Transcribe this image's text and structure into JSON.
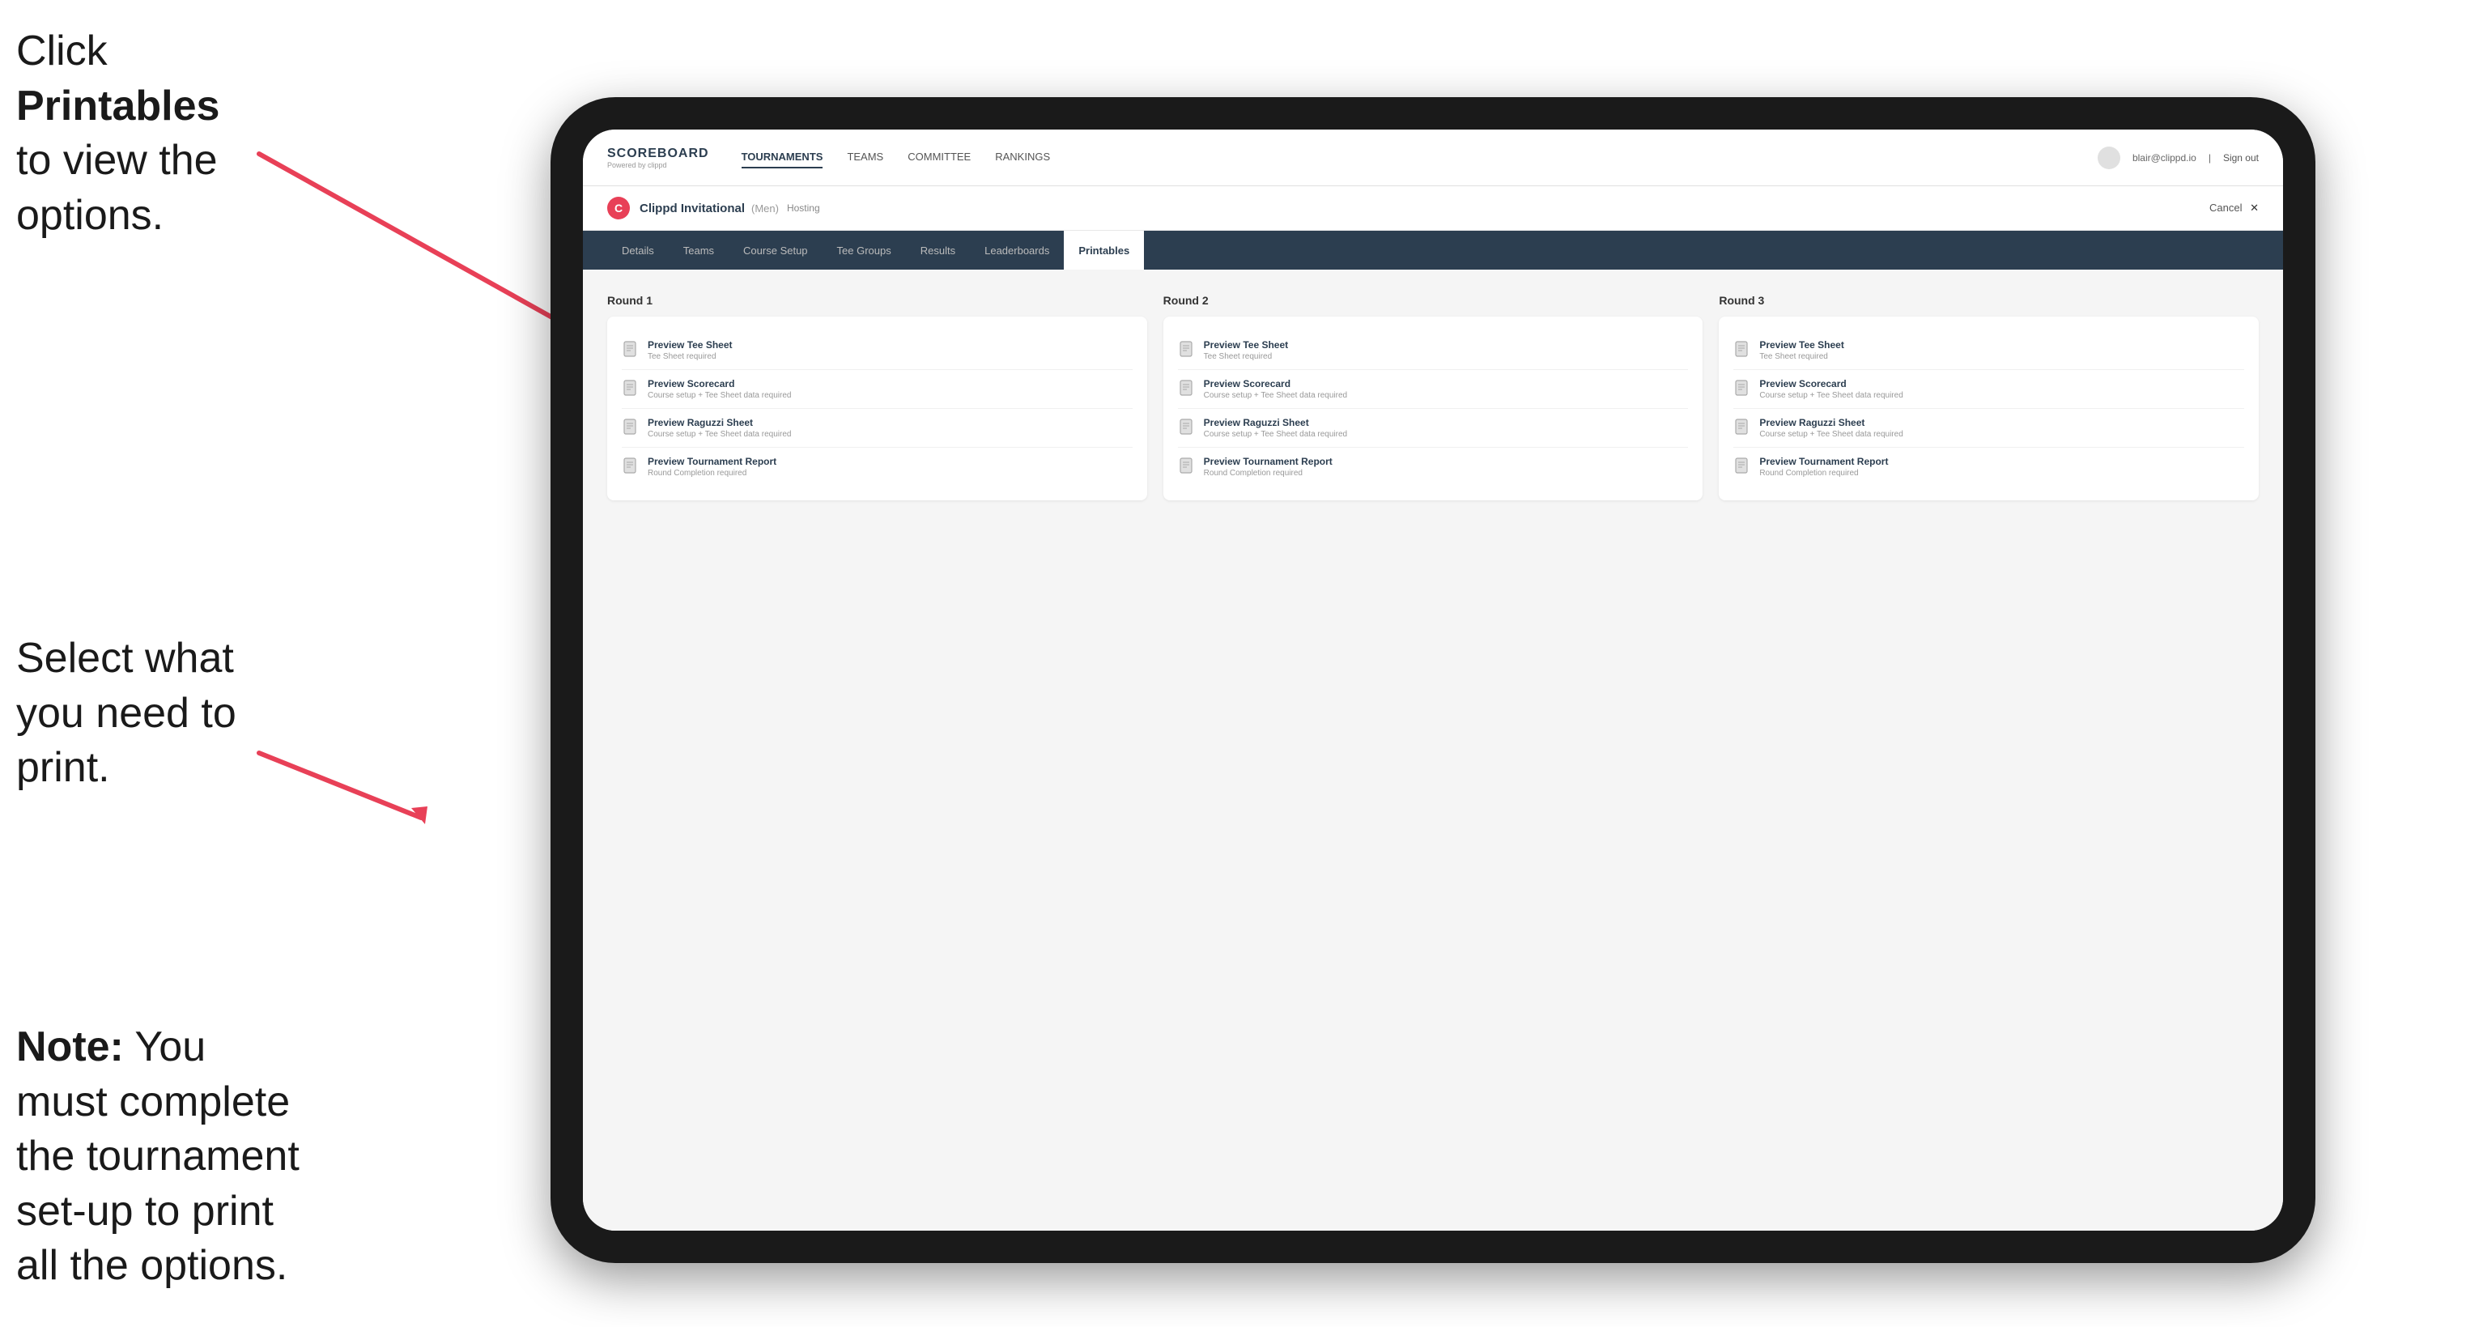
{
  "instructions": {
    "top_line1": "Click ",
    "top_bold": "Printables",
    "top_line2": " to",
    "top_line3": "view the options.",
    "middle": "Select what you\nneed to print.",
    "bottom_bold": "Note:",
    "bottom_rest": " You must\ncomplete the\ntournament set-up\nto print all the options."
  },
  "nav": {
    "brand": "SCOREBOARD",
    "brand_sub": "Powered by clippd",
    "links": [
      "TOURNAMENTS",
      "TEAMS",
      "COMMITTEE",
      "RANKINGS"
    ],
    "active_link": "TOURNAMENTS",
    "user_email": "blair@clippd.io",
    "sign_out": "Sign out"
  },
  "tournament": {
    "logo_letter": "C",
    "name": "Clippd Invitational",
    "sub": "(Men)",
    "status": "Hosting",
    "cancel": "Cancel"
  },
  "tabs": {
    "items": [
      "Details",
      "Teams",
      "Course Setup",
      "Tee Groups",
      "Results",
      "Leaderboards",
      "Printables"
    ],
    "active": "Printables"
  },
  "rounds": [
    {
      "title": "Round 1",
      "items": [
        {
          "label": "Preview Tee Sheet",
          "sub": "Tee Sheet required"
        },
        {
          "label": "Preview Scorecard",
          "sub": "Course setup + Tee Sheet data required"
        },
        {
          "label": "Preview Raguzzi Sheet",
          "sub": "Course setup + Tee Sheet data required"
        },
        {
          "label": "Preview Tournament Report",
          "sub": "Round Completion required"
        }
      ]
    },
    {
      "title": "Round 2",
      "items": [
        {
          "label": "Preview Tee Sheet",
          "sub": "Tee Sheet required"
        },
        {
          "label": "Preview Scorecard",
          "sub": "Course setup + Tee Sheet data required"
        },
        {
          "label": "Preview Raguzzi Sheet",
          "sub": "Course setup + Tee Sheet data required"
        },
        {
          "label": "Preview Tournament Report",
          "sub": "Round Completion required"
        }
      ]
    },
    {
      "title": "Round 3",
      "items": [
        {
          "label": "Preview Tee Sheet",
          "sub": "Tee Sheet required"
        },
        {
          "label": "Preview Scorecard",
          "sub": "Course setup + Tee Sheet data required"
        },
        {
          "label": "Preview Raguzzi Sheet",
          "sub": "Course setup + Tee Sheet data required"
        },
        {
          "label": "Preview Tournament Report",
          "sub": "Round Completion required"
        }
      ]
    }
  ],
  "colors": {
    "pink": "#e84057",
    "dark_nav": "#2c3e50"
  }
}
